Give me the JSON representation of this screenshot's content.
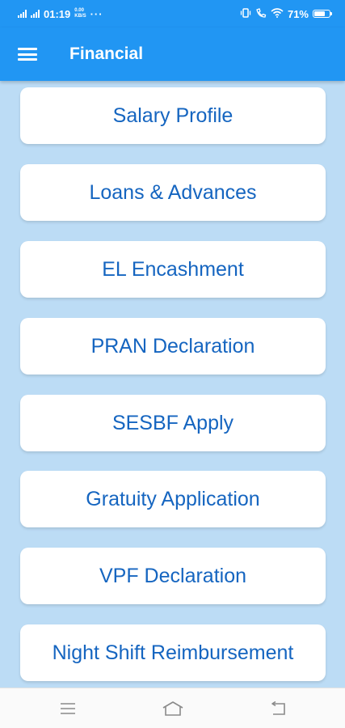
{
  "status_bar": {
    "net_speed_top": "0.00",
    "net_speed_bottom": "KB/S",
    "time": "01:19",
    "more": "···",
    "battery": "71%",
    "battery_level": 0.71,
    "icons": [
      "signal-icon",
      "vibrate-icon",
      "call-icon",
      "wifi-icon",
      "battery-icon"
    ]
  },
  "app_bar": {
    "title": "Financial",
    "menu_icon": "hamburger-menu-icon"
  },
  "menu_items": [
    {
      "label": "Salary Profile"
    },
    {
      "label": "Loans & Advances"
    },
    {
      "label": "EL Encashment"
    },
    {
      "label": "PRAN Declaration"
    },
    {
      "label": "SESBF Apply"
    },
    {
      "label": "Gratuity Application"
    },
    {
      "label": "VPF Declaration"
    },
    {
      "label": "Night Shift Reimbursement"
    }
  ],
  "nav_bar": {
    "icons": [
      "recent-apps-icon",
      "home-icon",
      "back-icon"
    ]
  },
  "colors": {
    "primary": "#2196f3",
    "background": "#bcdcf5",
    "card": "#ffffff",
    "card_text": "#1565c0"
  }
}
